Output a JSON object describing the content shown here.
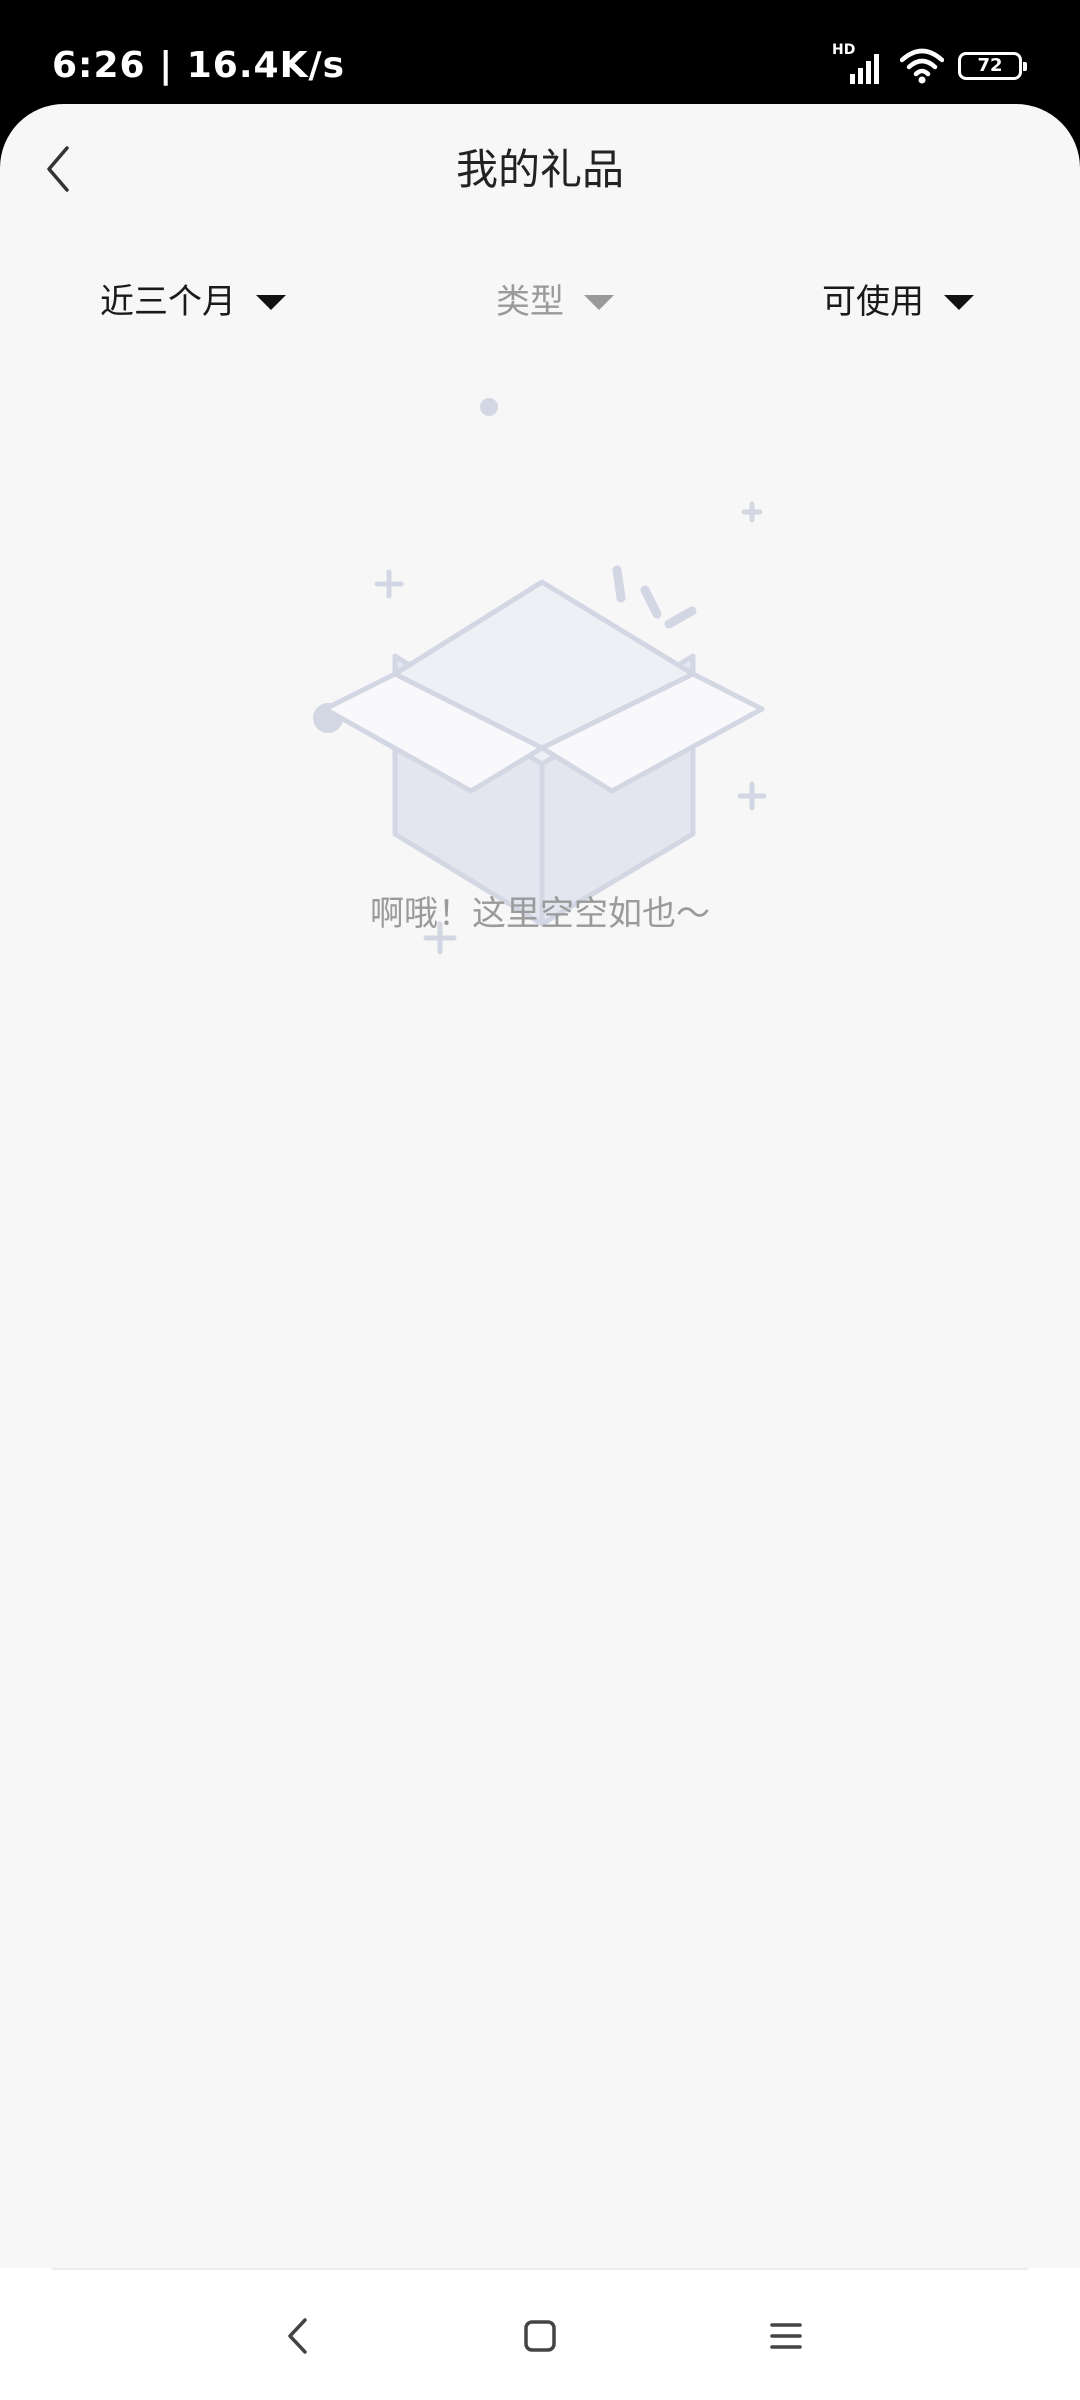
{
  "status_bar": {
    "time_speed": "6:26 | 16.4K/s",
    "network_label": "HD",
    "battery_level": "72",
    "icons": [
      "signal-icon",
      "wifi-icon",
      "battery-icon"
    ]
  },
  "header": {
    "title": "我的礼品",
    "back_icon": "back-chevron-icon"
  },
  "filters": [
    {
      "label": "近三个月",
      "state": "active"
    },
    {
      "label": "类型",
      "state": "disabled"
    },
    {
      "label": "可使用",
      "state": "active"
    }
  ],
  "empty_state": {
    "illustration": "empty-box-icon",
    "message": "啊哦！这里空空如也～"
  },
  "nav_bar": {
    "buttons": [
      "nav-back-icon",
      "nav-home-icon",
      "nav-menu-icon"
    ]
  },
  "colors": {
    "background": "#f7f7f7",
    "title_text": "#222222",
    "muted_text": "#9a9a9a",
    "illustration": "#d3d7e4"
  }
}
